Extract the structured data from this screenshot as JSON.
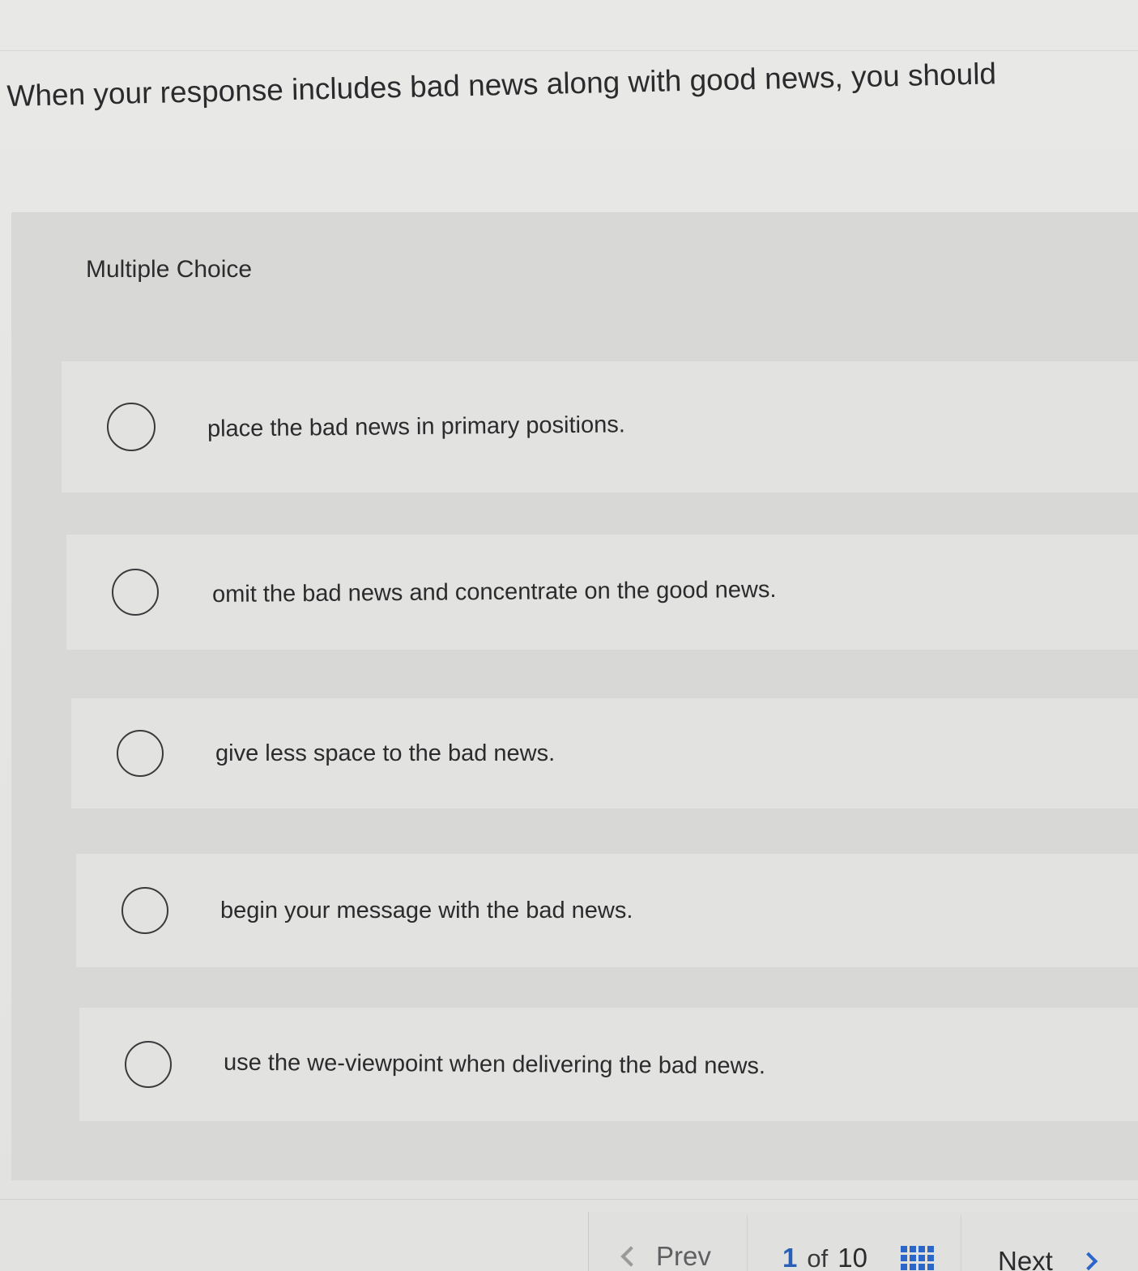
{
  "question": {
    "prompt": "When your response includes bad news along with good news, you should"
  },
  "answer_area": {
    "type_label": "Multiple Choice",
    "options": [
      {
        "text": "place the bad news in primary positions."
      },
      {
        "text": "omit the bad news and concentrate on the good news."
      },
      {
        "text": "give less space to the bad news."
      },
      {
        "text": "begin your message with the bad news."
      },
      {
        "text": "use the we-viewpoint when delivering the bad news."
      }
    ]
  },
  "navigation": {
    "prev_label": "Prev",
    "current_page": "1",
    "of_label": "of",
    "total_pages": "10",
    "next_label": "Next",
    "grid_icon": "question-grid-icon"
  },
  "colors": {
    "accent": "#2c66c9",
    "text": "#2b2b2d",
    "panel": "#d8d8d6",
    "option_bg": "#e2e2e0"
  }
}
